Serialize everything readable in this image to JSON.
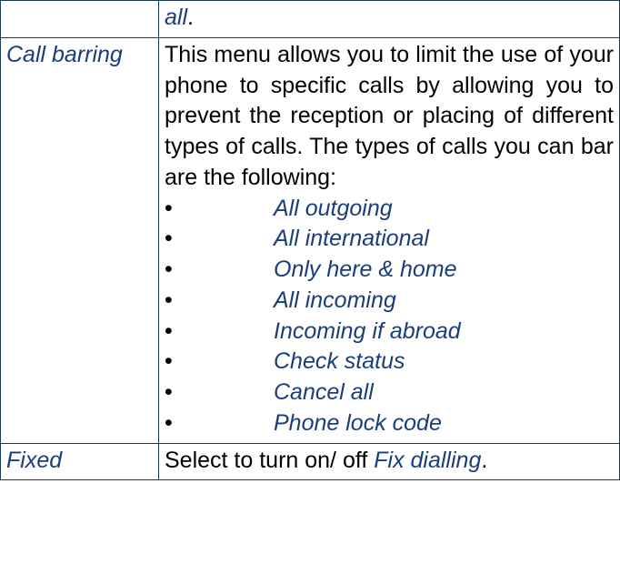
{
  "row0": {
    "label": "",
    "text_italic": "all",
    "text_after": "."
  },
  "row1": {
    "label": "Call barring",
    "intro": "This menu allows you to limit the use of your phone to specific calls by allowing you to prevent the reception or placing of different types of calls. The types of calls you can bar are the following:",
    "items": {
      "0": "All outgoing",
      "1": "All international",
      "2": "Only here & home",
      "3": "All incoming",
      "4": "Incoming if abroad",
      "5": "Check status",
      "6": "Cancel all",
      "7": "Phone lock code"
    },
    "bullet": "•"
  },
  "row2": {
    "label": "Fixed",
    "text_before": "Select to turn on/ off ",
    "text_italic": "Fix dialling",
    "text_after": "."
  }
}
